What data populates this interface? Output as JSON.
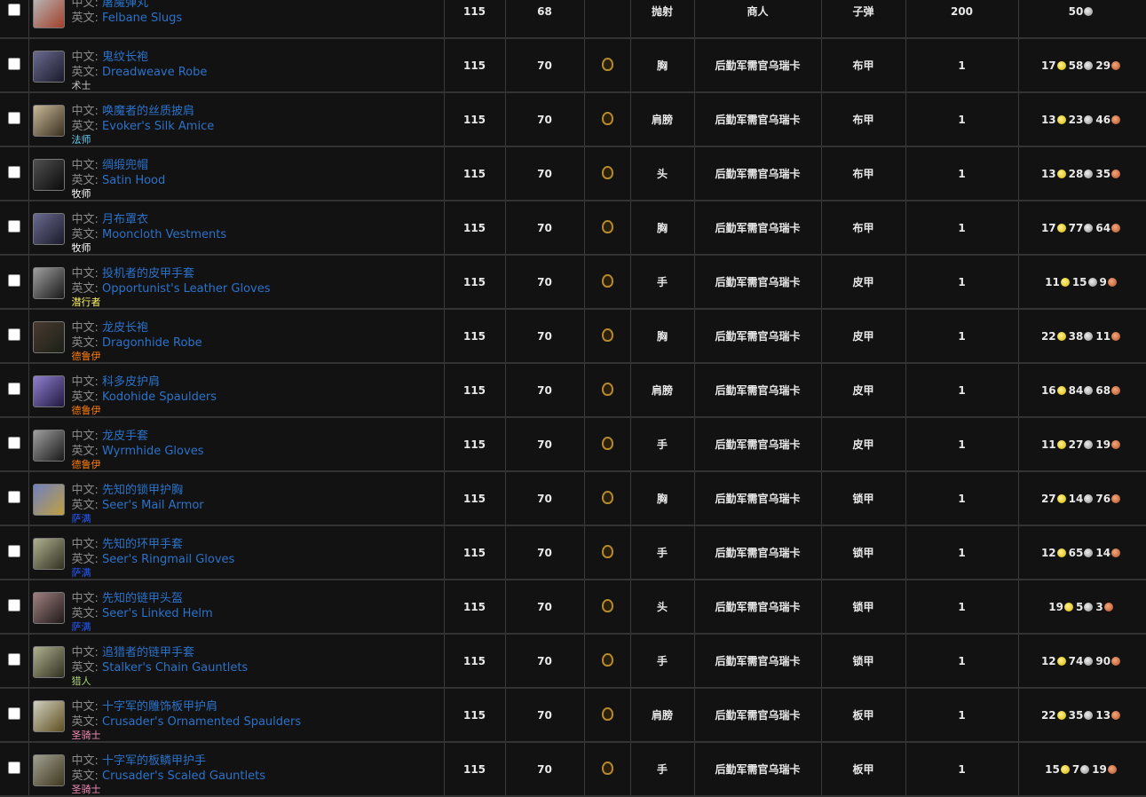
{
  "labels": {
    "cn": "中文:",
    "en": "英文:"
  },
  "colors": {
    "link": "#2b72c9",
    "warlock": "#c8c8c8",
    "mage": "#69ccf0",
    "priest": "#ffffff",
    "rogue": "#fff569",
    "druid": "#ff7d0a",
    "shaman": "#2459ff",
    "hunter": "#abd473",
    "paladin": "#f58cba"
  },
  "rows": [
    {
      "cn": "屠魔弹丸",
      "en": "Felbane Slugs",
      "cls": "",
      "clsColor": "",
      "ilvl": "115",
      "req": "68",
      "faction": false,
      "slot": "抛射",
      "source": "商人",
      "type": "子弹",
      "count": "200",
      "gold": "",
      "silver": "50",
      "copper": "",
      "iconA": "#b8b8b8",
      "iconB": "#a0402a"
    },
    {
      "cn": "鬼纹长袍",
      "en": "Dreadweave Robe",
      "cls": "术士",
      "clsColor": "warlock",
      "ilvl": "115",
      "req": "70",
      "faction": true,
      "slot": "胸",
      "source": "后勤军需官乌瑞卡",
      "type": "布甲",
      "count": "1",
      "gold": "17",
      "silver": "58",
      "copper": "29",
      "iconA": "#6a6a90",
      "iconB": "#1a1a2a"
    },
    {
      "cn": "唤魔者的丝质披肩",
      "en": "Evoker's Silk Amice",
      "cls": "法师",
      "clsColor": "mage",
      "ilvl": "115",
      "req": "70",
      "faction": true,
      "slot": "肩膀",
      "source": "后勤军需官乌瑞卡",
      "type": "布甲",
      "count": "1",
      "gold": "13",
      "silver": "23",
      "copper": "46",
      "iconA": "#c8b898",
      "iconB": "#3a3020"
    },
    {
      "cn": "绸缎兜帽",
      "en": "Satin Hood",
      "cls": "牧师",
      "clsColor": "priest",
      "ilvl": "115",
      "req": "70",
      "faction": true,
      "slot": "头",
      "source": "后勤军需官乌瑞卡",
      "type": "布甲",
      "count": "1",
      "gold": "13",
      "silver": "28",
      "copper": "35",
      "iconA": "#505050",
      "iconB": "#0a0a0a"
    },
    {
      "cn": "月布罩衣",
      "en": "Mooncloth Vestments",
      "cls": "牧师",
      "clsColor": "priest",
      "ilvl": "115",
      "req": "70",
      "faction": true,
      "slot": "胸",
      "source": "后勤军需官乌瑞卡",
      "type": "布甲",
      "count": "1",
      "gold": "17",
      "silver": "77",
      "copper": "64",
      "iconA": "#6a6a90",
      "iconB": "#1a1a2a"
    },
    {
      "cn": "投机者的皮甲手套",
      "en": "Opportunist's Leather Gloves",
      "cls": "潜行者",
      "clsColor": "rogue",
      "ilvl": "115",
      "req": "70",
      "faction": true,
      "slot": "手",
      "source": "后勤军需官乌瑞卡",
      "type": "皮甲",
      "count": "1",
      "gold": "11",
      "silver": "15",
      "copper": "9",
      "iconA": "#a0a0a0",
      "iconB": "#181818"
    },
    {
      "cn": "龙皮长袍",
      "en": "Dragonhide Robe",
      "cls": "德鲁伊",
      "clsColor": "druid",
      "ilvl": "115",
      "req": "70",
      "faction": true,
      "slot": "胸",
      "source": "后勤军需官乌瑞卡",
      "type": "皮甲",
      "count": "1",
      "gold": "22",
      "silver": "38",
      "copper": "11",
      "iconA": "#4a3a30",
      "iconB": "#1a2018"
    },
    {
      "cn": "科多皮护肩",
      "en": "Kodohide Spaulders",
      "cls": "德鲁伊",
      "clsColor": "druid",
      "ilvl": "115",
      "req": "70",
      "faction": true,
      "slot": "肩膀",
      "source": "后勤军需官乌瑞卡",
      "type": "皮甲",
      "count": "1",
      "gold": "16",
      "silver": "84",
      "copper": "68",
      "iconA": "#9080d0",
      "iconB": "#201840"
    },
    {
      "cn": "龙皮手套",
      "en": "Wyrmhide Gloves",
      "cls": "德鲁伊",
      "clsColor": "druid",
      "ilvl": "115",
      "req": "70",
      "faction": true,
      "slot": "手",
      "source": "后勤军需官乌瑞卡",
      "type": "皮甲",
      "count": "1",
      "gold": "11",
      "silver": "27",
      "copper": "19",
      "iconA": "#a0a0a0",
      "iconB": "#181818"
    },
    {
      "cn": "先知的锁甲护胸",
      "en": "Seer's Mail Armor",
      "cls": "萨满",
      "clsColor": "shaman",
      "ilvl": "115",
      "req": "70",
      "faction": true,
      "slot": "胸",
      "source": "后勤军需官乌瑞卡",
      "type": "锁甲",
      "count": "1",
      "gold": "27",
      "silver": "14",
      "copper": "76",
      "iconA": "#7080c0",
      "iconB": "#c0a040"
    },
    {
      "cn": "先知的环甲手套",
      "en": "Seer's Ringmail Gloves",
      "cls": "萨满",
      "clsColor": "shaman",
      "ilvl": "115",
      "req": "70",
      "faction": true,
      "slot": "手",
      "source": "后勤军需官乌瑞卡",
      "type": "锁甲",
      "count": "1",
      "gold": "12",
      "silver": "65",
      "copper": "14",
      "iconA": "#b0b090",
      "iconB": "#303020"
    },
    {
      "cn": "先知的链甲头盔",
      "en": "Seer's Linked Helm",
      "cls": "萨满",
      "clsColor": "shaman",
      "ilvl": "115",
      "req": "70",
      "faction": true,
      "slot": "头",
      "source": "后勤军需官乌瑞卡",
      "type": "锁甲",
      "count": "1",
      "gold": "19",
      "silver": "5",
      "copper": "3",
      "iconA": "#a08080",
      "iconB": "#201818"
    },
    {
      "cn": "追猎者的链甲手套",
      "en": "Stalker's Chain Gauntlets",
      "cls": "猎人",
      "clsColor": "hunter",
      "ilvl": "115",
      "req": "70",
      "faction": true,
      "slot": "手",
      "source": "后勤军需官乌瑞卡",
      "type": "锁甲",
      "count": "1",
      "gold": "12",
      "silver": "74",
      "copper": "90",
      "iconA": "#b0b090",
      "iconB": "#303020"
    },
    {
      "cn": "十字军的雕饰板甲护肩",
      "en": "Crusader's Ornamented Spaulders",
      "cls": "圣骑士",
      "clsColor": "paladin",
      "ilvl": "115",
      "req": "70",
      "faction": true,
      "slot": "肩膀",
      "source": "后勤军需官乌瑞卡",
      "type": "板甲",
      "count": "1",
      "gold": "22",
      "silver": "35",
      "copper": "13",
      "iconA": "#d0d0c0",
      "iconB": "#605020"
    },
    {
      "cn": "十字军的板鳞甲护手",
      "en": "Crusader's Scaled Gauntlets",
      "cls": "圣骑士",
      "clsColor": "paladin",
      "ilvl": "115",
      "req": "70",
      "faction": true,
      "slot": "手",
      "source": "后勤军需官乌瑞卡",
      "type": "板甲",
      "count": "1",
      "gold": "15",
      "silver": "7",
      "copper": "19",
      "iconA": "#a0a090",
      "iconB": "#403820"
    }
  ]
}
